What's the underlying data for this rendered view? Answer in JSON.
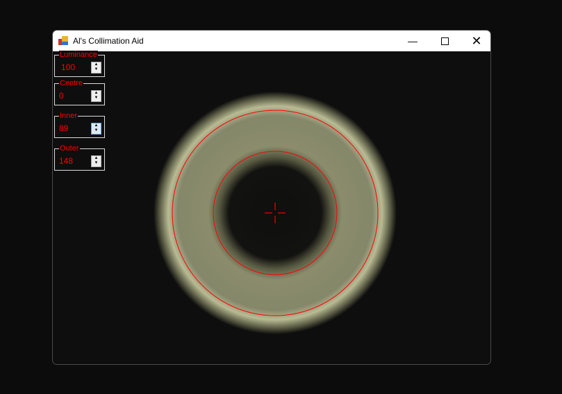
{
  "window": {
    "title": "Al's Collimation Aid",
    "minimize_icon": "minimize-icon",
    "maximize_icon": "maximize-icon",
    "close_icon": "close-icon"
  },
  "controls": [
    {
      "label": "Luminance",
      "value": "100"
    },
    {
      "label": "Centre",
      "value": "0"
    },
    {
      "label": "Inner",
      "value": "89"
    },
    {
      "label": "Outer",
      "value": "148"
    }
  ],
  "overlay": {
    "inner_radius": 89,
    "outer_radius": 148,
    "color": "#ff0000"
  }
}
